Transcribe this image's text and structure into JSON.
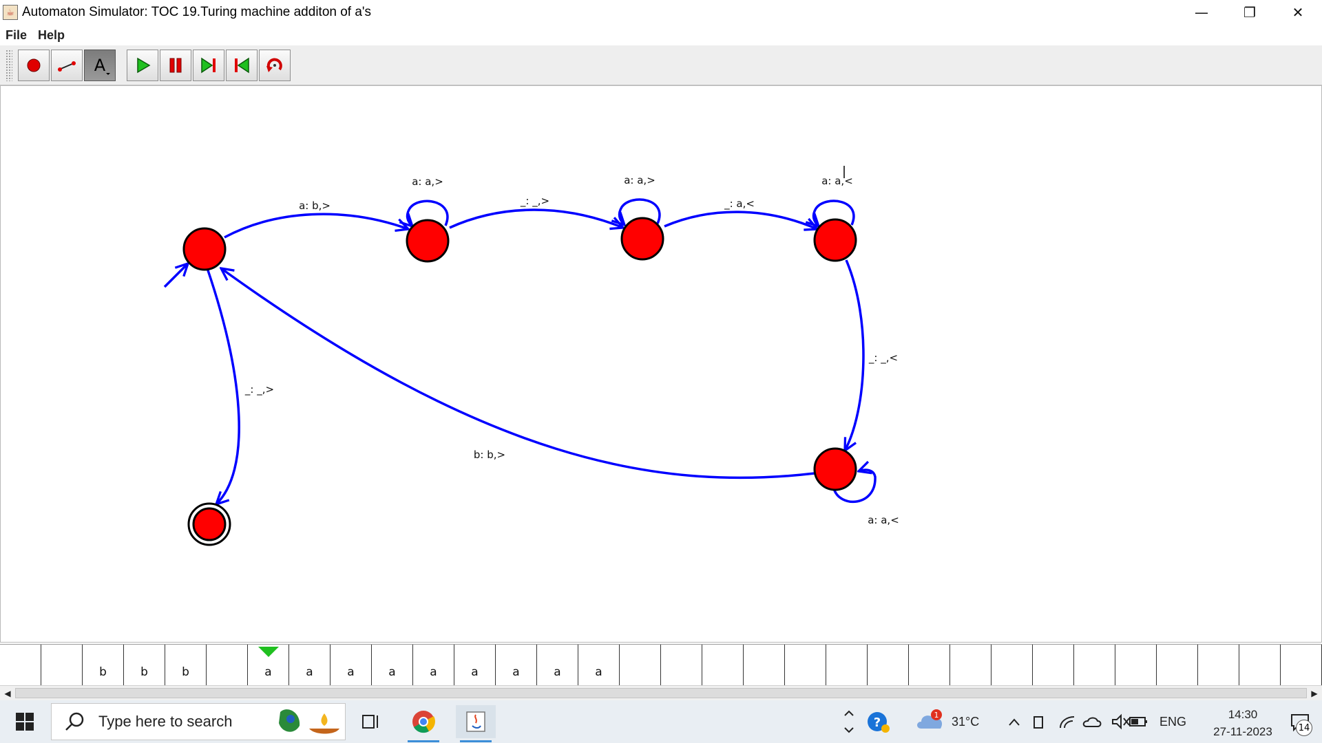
{
  "window": {
    "title": "Automaton Simulator: TOC 19.Turing machine additon of a's",
    "controls": {
      "minimize": "—",
      "restore": "❐",
      "close": "✕"
    }
  },
  "menu": {
    "items": [
      "File",
      "Help"
    ]
  },
  "toolbar": {
    "buttons": [
      {
        "name": "add-state",
        "icon": "red-circle-icon"
      },
      {
        "name": "add-transition",
        "icon": "transition-arrow-icon"
      },
      {
        "name": "edit-label",
        "icon": "text-a-icon",
        "label": "A",
        "pressed": true
      },
      {
        "name": "play",
        "icon": "play-icon"
      },
      {
        "name": "pause",
        "icon": "pause-icon"
      },
      {
        "name": "step-forward",
        "icon": "step-forward-icon"
      },
      {
        "name": "step-back",
        "icon": "step-back-icon"
      },
      {
        "name": "reset",
        "icon": "reset-icon"
      }
    ]
  },
  "diagram": {
    "state_color": "#ff0000",
    "edge_color": "#0000ff",
    "states": [
      "q0",
      "q1",
      "q2",
      "q3",
      "q4",
      "q5"
    ],
    "start_state": "q0",
    "accept_state": "q5",
    "transitions": [
      {
        "from": "q0",
        "to": "q1",
        "label": "a: b,>"
      },
      {
        "from": "q1",
        "to": "q1",
        "label": "a: a,>"
      },
      {
        "from": "q1",
        "to": "q2",
        "label": "_: _,>"
      },
      {
        "from": "q2",
        "to": "q2",
        "label": "a: a,>"
      },
      {
        "from": "q2",
        "to": "q3",
        "label": "_: a,<"
      },
      {
        "from": "q3",
        "to": "q3",
        "label": "a: a,<"
      },
      {
        "from": "q3",
        "to": "q4",
        "label": "_: _,<"
      },
      {
        "from": "q4",
        "to": "q4",
        "label": "a: a,<"
      },
      {
        "from": "q4",
        "to": "q0",
        "label": "b: b,>"
      },
      {
        "from": "q0",
        "to": "q5",
        "label": "_: _,>"
      }
    ]
  },
  "tape": {
    "cells": [
      "",
      "",
      "b",
      "b",
      "b",
      "",
      "a",
      "a",
      "a",
      "a",
      "a",
      "a",
      "a",
      "a",
      "a",
      "",
      "",
      "",
      "",
      "",
      "",
      "",
      "",
      "",
      "",
      "",
      "",
      "",
      "",
      "",
      "",
      ""
    ],
    "head_index": 6,
    "head_color": "#20c020"
  },
  "taskbar": {
    "search_placeholder": "Type here to search",
    "apps": [
      "file-explorer",
      "chrome",
      "java"
    ],
    "weather": "31°C",
    "weather_badge": "1",
    "language": "ENG",
    "time": "14:30",
    "date": "27-11-2023",
    "notification_count": "14"
  }
}
